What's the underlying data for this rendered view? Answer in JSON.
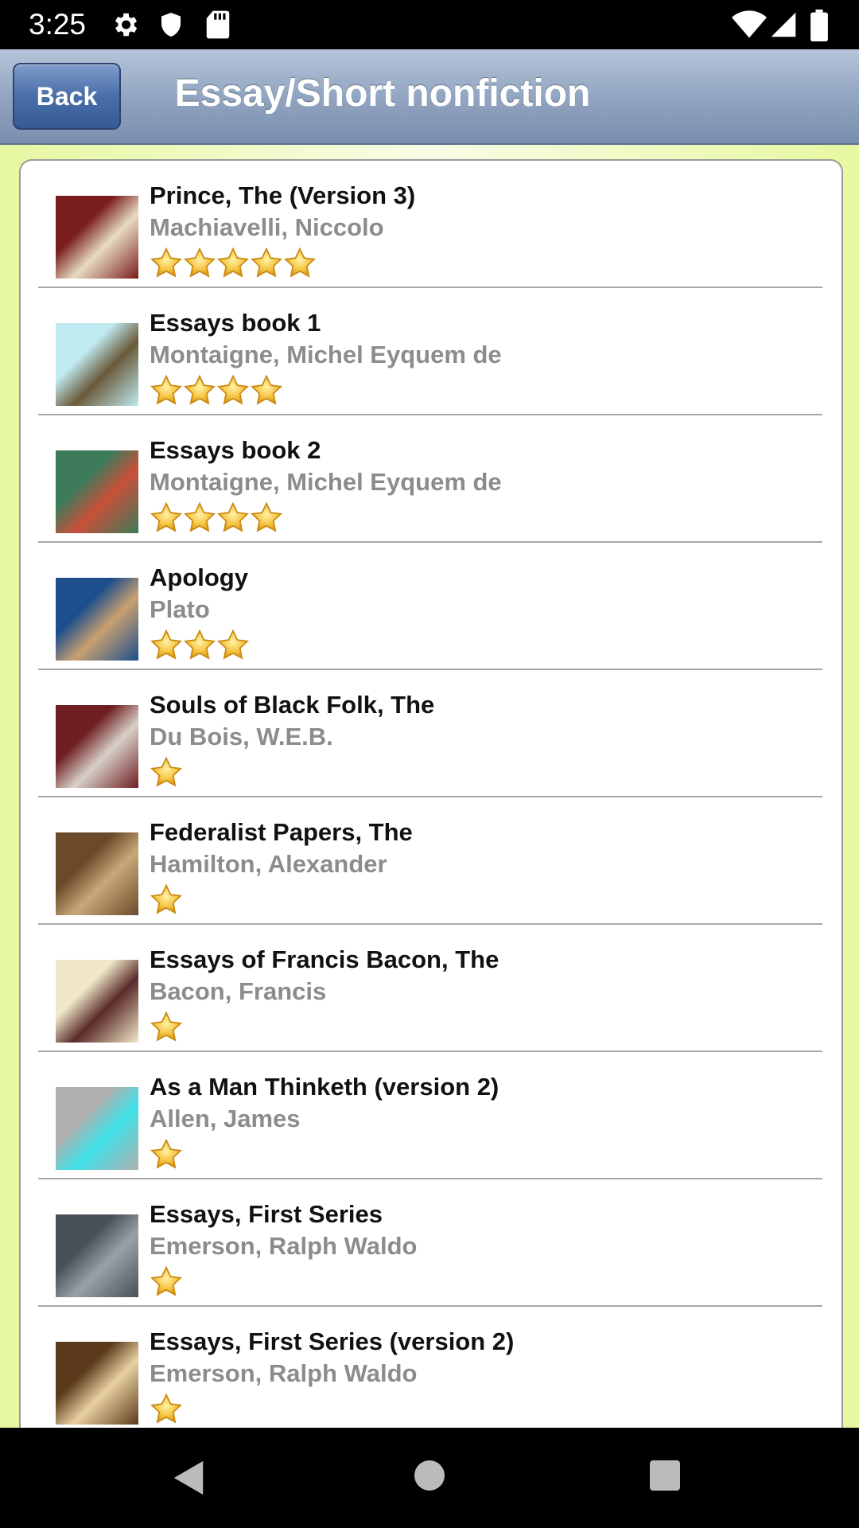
{
  "status_bar": {
    "time": "3:25",
    "icons": [
      "settings-gear-icon",
      "shield-icon",
      "sd-card-icon",
      "wifi-icon",
      "signal-icon",
      "battery-icon"
    ]
  },
  "header": {
    "back_label": "Back",
    "title": "Essay/Short nonfiction"
  },
  "books": [
    {
      "title": "Prince, The (Version 3)",
      "author": "Machiavelli, Niccolo",
      "rating": 5,
      "cover_colors": [
        "#7a1d1d",
        "#e8dcc0"
      ]
    },
    {
      "title": "Essays book 1",
      "author": "Montaigne, Michel Eyquem de",
      "rating": 4,
      "cover_colors": [
        "#bfeaf0",
        "#6a5a3a"
      ]
    },
    {
      "title": "Essays book 2",
      "author": "Montaigne, Michel Eyquem de",
      "rating": 4,
      "cover_colors": [
        "#3d7a5a",
        "#c9503a"
      ]
    },
    {
      "title": "Apology",
      "author": "Plato",
      "rating": 3,
      "cover_colors": [
        "#1e4f8c",
        "#c8a070"
      ]
    },
    {
      "title": "Souls of Black Folk, The",
      "author": "Du Bois, W.E.B.",
      "rating": 1,
      "cover_colors": [
        "#6e1f22",
        "#d8d0c8"
      ]
    },
    {
      "title": "Federalist Papers, The",
      "author": "Hamilton, Alexander",
      "rating": 1,
      "cover_colors": [
        "#6b4a2a",
        "#c8a878"
      ]
    },
    {
      "title": "Essays of Francis Bacon, The",
      "author": "Bacon, Francis",
      "rating": 1,
      "cover_colors": [
        "#f0e8c8",
        "#5a2a2a"
      ]
    },
    {
      "title": "As a Man Thinketh (version 2)",
      "author": "Allen, James",
      "rating": 1,
      "cover_colors": [
        "#b0b0b0",
        "#3fe0e8"
      ]
    },
    {
      "title": "Essays, First Series",
      "author": "Emerson, Ralph Waldo",
      "rating": 1,
      "cover_colors": [
        "#4a5058",
        "#9aa0a8"
      ]
    },
    {
      "title": "Essays, First Series (version 2)",
      "author": "Emerson, Ralph Waldo",
      "rating": 1,
      "cover_colors": [
        "#5a3a1a",
        "#e8d0a0"
      ]
    }
  ],
  "nav_bar": {
    "icons": [
      "back-triangle-icon",
      "home-circle-icon",
      "recents-square-icon"
    ]
  }
}
